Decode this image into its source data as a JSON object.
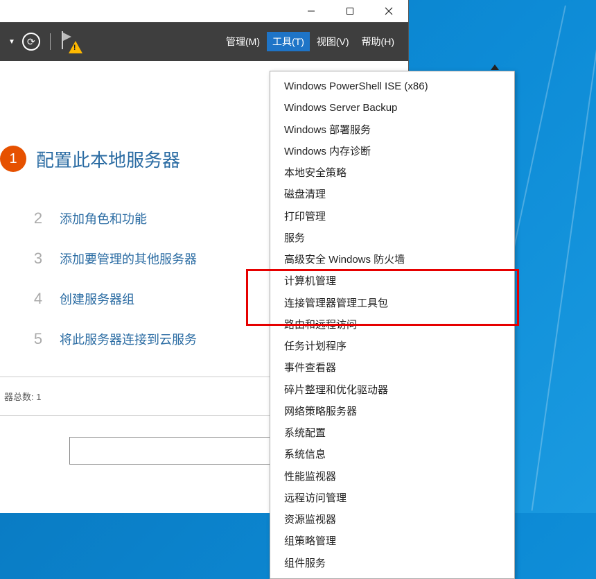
{
  "menubar": {
    "manage": "管理(M)",
    "tools": "工具(T)",
    "view": "视图(V)",
    "help": "帮助(H)"
  },
  "steps": [
    {
      "num": "1",
      "label": "配置此本地服务器"
    },
    {
      "num": "2",
      "label": "添加角色和功能"
    },
    {
      "num": "3",
      "label": "添加要管理的其他服务器"
    },
    {
      "num": "4",
      "label": "创建服务器组"
    },
    {
      "num": "5",
      "label": "将此服务器连接到云服务"
    }
  ],
  "bottom": {
    "count_label": "器总数: 1"
  },
  "dropdown_items": [
    "Windows PowerShell ISE (x86)",
    "Windows Server Backup",
    "Windows 部署服务",
    "Windows 内存诊断",
    "本地安全策略",
    "磁盘清理",
    "打印管理",
    "服务",
    "高级安全 Windows 防火墙",
    "计算机管理",
    "连接管理器管理工具包",
    "路由和远程访问",
    "任务计划程序",
    "事件查看器",
    "碎片整理和优化驱动器",
    "网络策略服务器",
    "系统配置",
    "系统信息",
    "性能监视器",
    "远程访问管理",
    "资源监视器",
    "组策略管理",
    "组件服务"
  ]
}
